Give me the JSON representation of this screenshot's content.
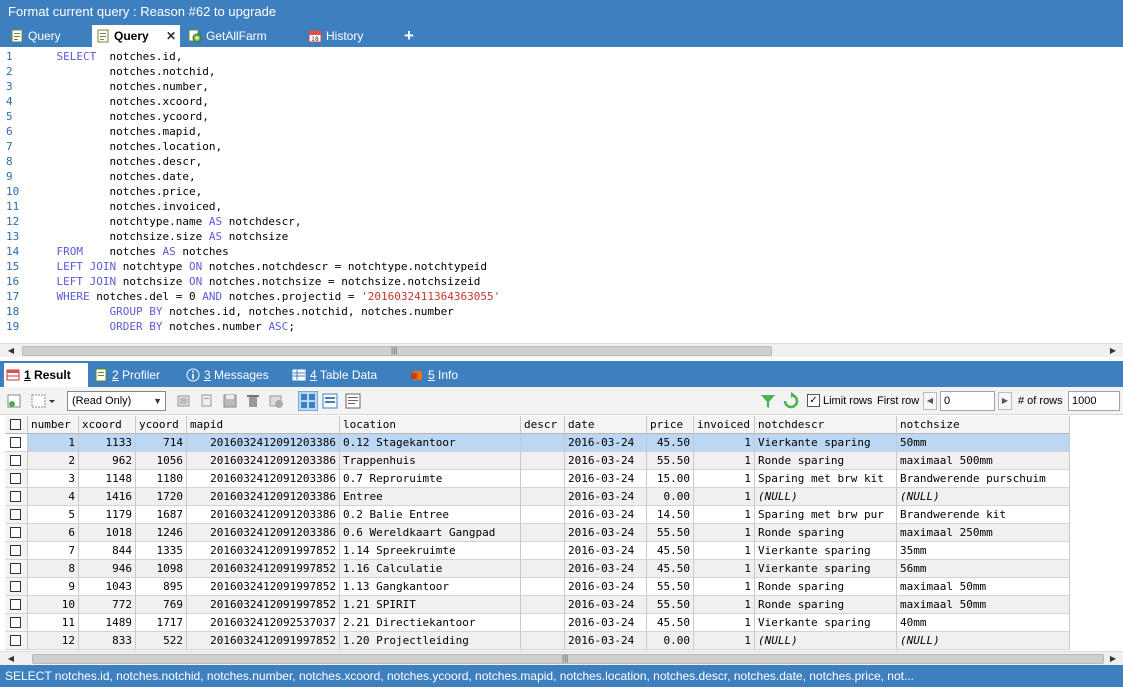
{
  "window": {
    "title": "Format current query : Reason #62 to upgrade"
  },
  "query_tabs": [
    {
      "label": "Query",
      "active": false
    },
    {
      "label": "Query",
      "active": true,
      "close": "✕"
    },
    {
      "label": "GetAllFarm",
      "active": false
    },
    {
      "label": "History",
      "active": false
    }
  ],
  "add_tab_label": "+",
  "editor": {
    "lines": [
      {
        "n": "1",
        "parts": [
          [
            "kw",
            "SELECT"
          ],
          [
            "",
            "  notches.id,"
          ]
        ]
      },
      {
        "n": "2",
        "parts": [
          [
            "",
            "        notches.notchid,"
          ]
        ]
      },
      {
        "n": "3",
        "parts": [
          [
            "",
            "        notches.number,"
          ]
        ]
      },
      {
        "n": "4",
        "parts": [
          [
            "",
            "        notches.xcoord,"
          ]
        ]
      },
      {
        "n": "5",
        "parts": [
          [
            "",
            "        notches.ycoord,"
          ]
        ]
      },
      {
        "n": "6",
        "parts": [
          [
            "",
            "        notches.mapid,"
          ]
        ]
      },
      {
        "n": "7",
        "parts": [
          [
            "",
            "        notches.location,"
          ]
        ]
      },
      {
        "n": "8",
        "parts": [
          [
            "",
            "        notches.descr,"
          ]
        ]
      },
      {
        "n": "9",
        "parts": [
          [
            "",
            "        notches.date,"
          ]
        ]
      },
      {
        "n": "10",
        "parts": [
          [
            "",
            "        notches.price,"
          ]
        ]
      },
      {
        "n": "11",
        "parts": [
          [
            "",
            "        notches.invoiced,"
          ]
        ]
      },
      {
        "n": "12",
        "parts": [
          [
            "",
            "        notchtype.name "
          ],
          [
            "kw",
            "AS"
          ],
          [
            "",
            " notchdescr,"
          ]
        ]
      },
      {
        "n": "13",
        "parts": [
          [
            "",
            "        notchsize.size "
          ],
          [
            "kw",
            "AS"
          ],
          [
            "",
            " notchsize"
          ]
        ]
      },
      {
        "n": "14",
        "parts": [
          [
            "kw",
            "FROM"
          ],
          [
            "",
            "    notches "
          ],
          [
            "kw",
            "AS"
          ],
          [
            "",
            " notches"
          ]
        ]
      },
      {
        "n": "15",
        "parts": [
          [
            "kw",
            "LEFT JOIN"
          ],
          [
            "",
            " notchtype "
          ],
          [
            "kw",
            "ON"
          ],
          [
            "",
            " notches.notchdescr = notchtype.notchtypeid"
          ]
        ]
      },
      {
        "n": "16",
        "parts": [
          [
            "kw",
            "LEFT JOIN"
          ],
          [
            "",
            " notchsize "
          ],
          [
            "kw",
            "ON"
          ],
          [
            "",
            " notches.notchsize = notchsize.notchsizeid"
          ]
        ]
      },
      {
        "n": "17",
        "parts": [
          [
            "kw",
            "WHERE"
          ],
          [
            "",
            " notches.del = 0 "
          ],
          [
            "kw",
            "AND"
          ],
          [
            "",
            " notches.projectid = "
          ],
          [
            "str",
            "'2016032411364363055'"
          ]
        ]
      },
      {
        "n": "18",
        "parts": [
          [
            "",
            "        "
          ],
          [
            "kw",
            "GROUP BY"
          ],
          [
            "",
            " notches.id, notches.notchid, notches.number"
          ]
        ]
      },
      {
        "n": "19",
        "parts": [
          [
            "",
            "        "
          ],
          [
            "kw",
            "ORDER BY"
          ],
          [
            "",
            " notches.number "
          ],
          [
            "kw",
            "ASC"
          ],
          [
            "",
            ";"
          ]
        ]
      }
    ]
  },
  "result_tabs": [
    {
      "num": "1",
      "label": "Result",
      "active": true
    },
    {
      "num": "2",
      "label": "Profiler",
      "active": false
    },
    {
      "num": "3",
      "label": "Messages",
      "active": false
    },
    {
      "num": "4",
      "label": "Table Data",
      "active": false
    },
    {
      "num": "5",
      "label": "Info",
      "active": false
    }
  ],
  "toolbar": {
    "read_only": "(Read Only)",
    "limit_rows_label": "Limit rows",
    "limit_rows_checked": "✓",
    "first_row_label": "First row",
    "first_row_value": "0",
    "rows_label": "# of rows",
    "rows_value": "1000"
  },
  "grid": {
    "columns": [
      "number",
      "xcoord",
      "ycoord",
      "mapid",
      "location",
      "descr",
      "date",
      "price",
      "invoiced",
      "notchdescr",
      "notchsize"
    ],
    "rows": [
      [
        "1",
        "1133",
        "714",
        "20160324120912033 86",
        "0.12 Stagekantoor",
        "",
        "2016-03-24",
        "45.50",
        "1",
        "Vierkante sparing",
        "50mm"
      ],
      [
        "2",
        "962",
        "1056",
        "2016032412091203386",
        "Trappenhuis",
        "",
        "2016-03-24",
        "55.50",
        "1",
        "Ronde sparing",
        "maximaal 500mm"
      ],
      [
        "3",
        "1148",
        "1180",
        "2016032412091203386",
        "0.7 Reproruimte",
        "",
        "2016-03-24",
        "15.00",
        "1",
        "Sparing met brw kit",
        "Brandwerende purschuim"
      ],
      [
        "4",
        "1416",
        "1720",
        "2016032412091203386",
        "Entree",
        "",
        "2016-03-24",
        "0.00",
        "1",
        "(NULL)",
        "(NULL)"
      ],
      [
        "5",
        "1179",
        "1687",
        "2016032412091203386",
        "0.2 Balie Entree",
        "",
        "2016-03-24",
        "14.50",
        "1",
        "Sparing met brw pur",
        "Brandwerende kit"
      ],
      [
        "6",
        "1018",
        "1246",
        "2016032412091203386",
        "0.6 Wereldkaart Gangpad",
        "",
        "2016-03-24",
        "55.50",
        "1",
        "Ronde sparing",
        "maximaal 250mm"
      ],
      [
        "7",
        "844",
        "1335",
        "2016032412091997852",
        "1.14 Spreekruimte",
        "",
        "2016-03-24",
        "45.50",
        "1",
        "Vierkante sparing",
        "35mm"
      ],
      [
        "8",
        "946",
        "1098",
        "2016032412091997852",
        "1.16 Calculatie",
        "",
        "2016-03-24",
        "45.50",
        "1",
        "Vierkante sparing",
        "56mm"
      ],
      [
        "9",
        "1043",
        "895",
        "2016032412091997852",
        "1.13 Gangkantoor",
        "",
        "2016-03-24",
        "55.50",
        "1",
        "Ronde sparing",
        "maximaal 50mm"
      ],
      [
        "10",
        "772",
        "769",
        "2016032412091997852",
        "1.21 SPIRIT",
        "",
        "2016-03-24",
        "55.50",
        "1",
        "Ronde sparing",
        "maximaal 50mm"
      ],
      [
        "11",
        "1489",
        "1717",
        "2016032412092537037",
        "2.21 Directiekantoor",
        "",
        "2016-03-24",
        "45.50",
        "1",
        "Vierkante sparing",
        "40mm"
      ],
      [
        "12",
        "833",
        "522",
        "2016032412091997852",
        "1.20 Projectleiding",
        "",
        "2016-03-24",
        "0.00",
        "1",
        "(NULL)",
        "(NULL)"
      ]
    ]
  },
  "status": {
    "text": "SELECT notches.id, notches.notchid, notches.number, notches.xcoord, notches.ycoord, notches.mapid, notches.location, notches.descr, notches.date, notches.price, not..."
  },
  "colors": {
    "chrome": "#3d7fbf",
    "selected_row": "#bcd7f4",
    "keyword": "#5b5bd6",
    "string": "#c0392b"
  },
  "icons": [
    "query-icon",
    "gear-query-icon",
    "calendar-icon",
    "close-icon",
    "add-tab-icon",
    "result-grid-icon",
    "profiler-icon",
    "info-icon",
    "table-icon",
    "office-icon",
    "filter-icon",
    "refresh-icon"
  ]
}
